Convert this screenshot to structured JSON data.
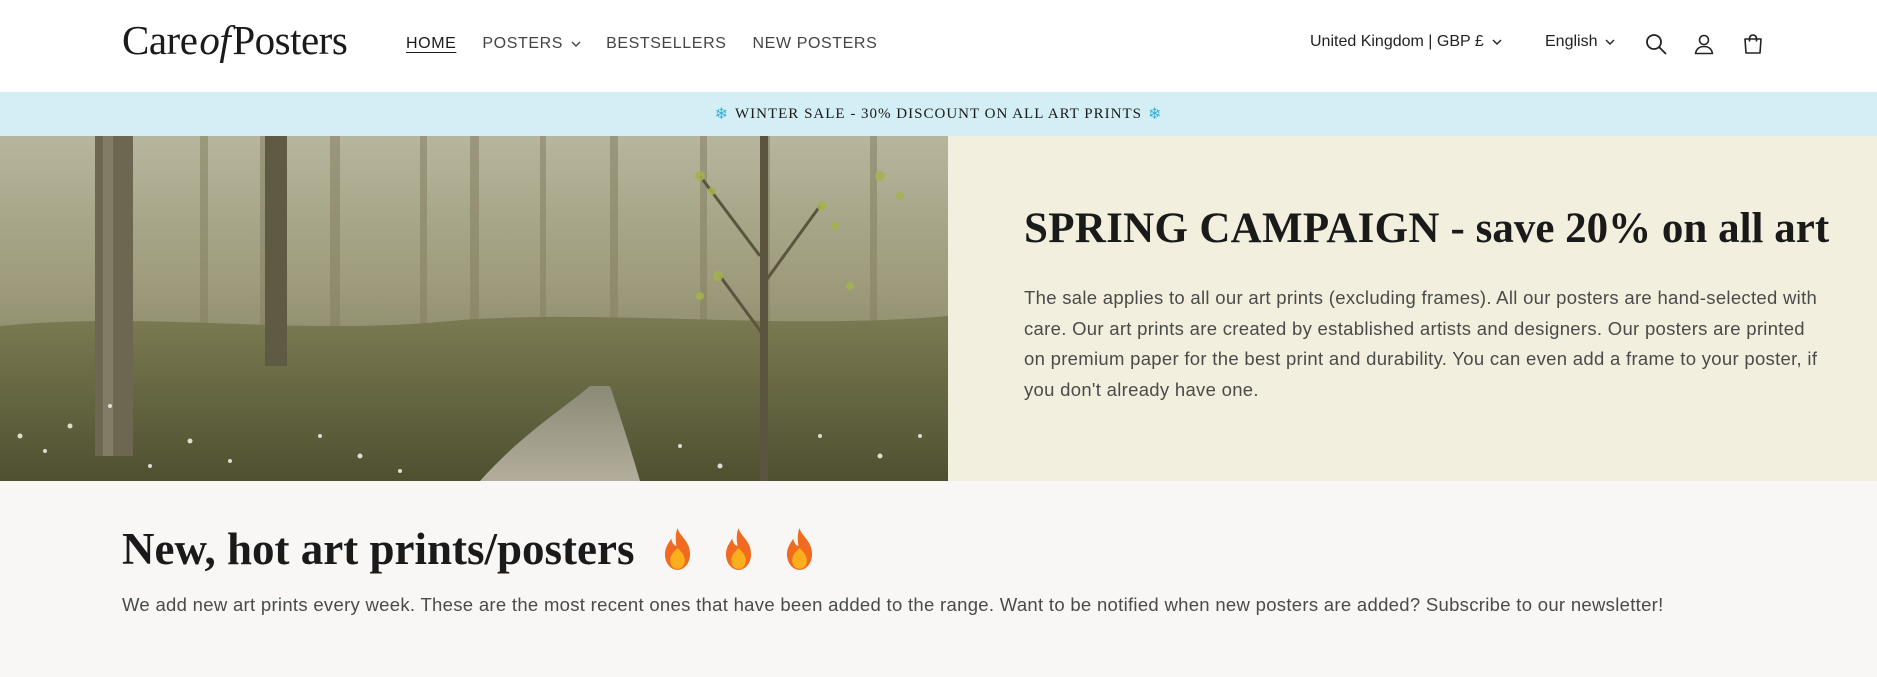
{
  "header": {
    "logo": {
      "part1": "Care",
      "part2": "of",
      "part3": "Posters"
    },
    "nav": [
      {
        "label": "HOME"
      },
      {
        "label": "POSTERS"
      },
      {
        "label": "BESTSELLERS"
      },
      {
        "label": "NEW POSTERS"
      }
    ],
    "country_selector": "United Kingdom | GBP £",
    "language_selector": "English",
    "icons": [
      "search-icon",
      "account-icon",
      "cart-icon"
    ]
  },
  "announcement": {
    "text": "WINTER SALE - 30% DISCOUNT ON ALL ART PRINTS",
    "icon": "❄"
  },
  "hero": {
    "image_alt": "forest-stream-image",
    "title_strong": "SPRING CAMPAIGN",
    "title_rest": " - save 20% on all art",
    "body": "The sale applies to all our art prints (excluding frames). All our posters are hand-selected with care. Our art prints are created by established artists and designers. Our posters are printed on premium paper for the best print and durability. You can even add a frame to your poster, if you don't already have one."
  },
  "section": {
    "title": "New, hot art prints/posters",
    "body": "We add new art prints every week. These are the most recent ones that have been added to the range. Want to be notified when new posters are added? Subscribe to our newsletter!"
  },
  "colors": {
    "announcement_bg": "#d3eef4",
    "hero_panel_bg": "#f3efde",
    "section_bg": "#f8f7f5",
    "snowflake": "#3ab0d6"
  }
}
